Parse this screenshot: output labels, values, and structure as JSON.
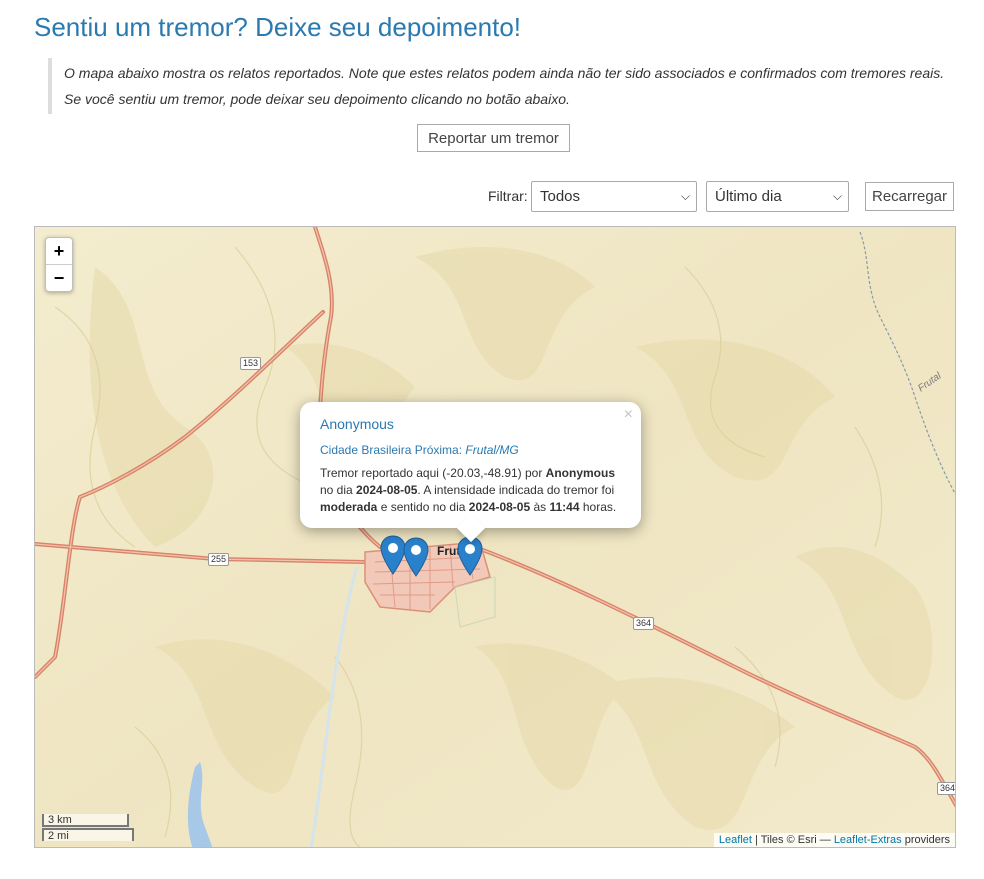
{
  "page": {
    "title": "Sentiu um tremor? Deixe seu depoimento!",
    "intro_line1": "O mapa abaixo mostra os relatos reportados. Note que estes relatos podem ainda não ter sido associados e confirmados com tremores reais.",
    "intro_line2": "Se você sentiu um tremor, pode deixar seu depoimento clicando no botão abaixo.",
    "report_button": "Reportar um tremor"
  },
  "filters": {
    "label": "Filtrar:",
    "type_selected": "Todos",
    "period_selected": "Último dia",
    "reload_button": "Recarregar"
  },
  "map": {
    "zoom_in": "+",
    "zoom_out": "−",
    "town_label": "Frut",
    "river_label": "Frutal",
    "road_shields": [
      "153",
      "255",
      "364",
      "364"
    ],
    "scale_metric": "3 km",
    "scale_imperial": "2 mi",
    "attribution": {
      "leaflet": "Leaflet",
      "tiles": "| Tiles © Esri —",
      "extras": "Leaflet-Extras",
      "providers": "providers"
    },
    "marker_color": "#2a81cb"
  },
  "popup": {
    "close": "×",
    "name": "Anonymous",
    "city_label": "Cidade Brasileira Próxima:",
    "city_value": "Frutal/MG",
    "text_1": "Tremor reportado aqui (-20.03,-48.91) por ",
    "reporter": "Anonymous",
    "text_2": " no dia ",
    "report_date": "2024-08-05",
    "text_3": ". A intensidade indicada do tremor foi ",
    "intensity": "moderada",
    "text_4": " e sentido no dia ",
    "felt_date": "2024-08-05",
    "text_5": " às ",
    "felt_time": "11:44",
    "text_6": " horas."
  }
}
